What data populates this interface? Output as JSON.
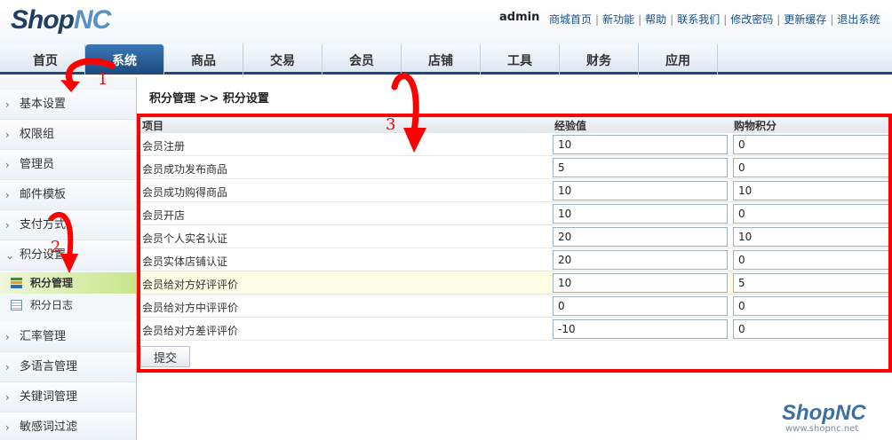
{
  "brand": {
    "logo_part1": "Shop",
    "logo_part2": "NC"
  },
  "header": {
    "admin_name": "admin",
    "links": [
      "商城首页",
      "新功能",
      "帮助",
      "联系我们",
      "修改密码",
      "更新缓存",
      "退出系统"
    ]
  },
  "nav": {
    "tabs": [
      {
        "label": "首页"
      },
      {
        "label": "系统"
      },
      {
        "label": "商品"
      },
      {
        "label": "交易"
      },
      {
        "label": "会员"
      },
      {
        "label": "店铺"
      },
      {
        "label": "工具"
      },
      {
        "label": "财务"
      },
      {
        "label": "应用"
      }
    ],
    "active_index": 1
  },
  "sidebar": {
    "items": [
      {
        "label": "基本设置"
      },
      {
        "label": "权限组"
      },
      {
        "label": "管理员"
      },
      {
        "label": "邮件模板"
      },
      {
        "label": "支付方式"
      },
      {
        "label": "积分设置"
      }
    ],
    "subitems": [
      {
        "label": "积分管理"
      },
      {
        "label": "积分日志"
      }
    ],
    "items_after": [
      {
        "label": "汇率管理"
      },
      {
        "label": "多语言管理"
      },
      {
        "label": "关键词管理"
      },
      {
        "label": "敏感词过滤"
      }
    ]
  },
  "main": {
    "breadcrumb": "积分管理 >> 积分设置",
    "columns": {
      "item": "项目",
      "exp": "经验值",
      "points": "购物积分"
    },
    "rows": [
      {
        "label": "会员注册",
        "exp": "10",
        "points": "0"
      },
      {
        "label": "会员成功发布商品",
        "exp": "5",
        "points": "0"
      },
      {
        "label": "会员成功购得商品",
        "exp": "10",
        "points": "10"
      },
      {
        "label": "会员开店",
        "exp": "10",
        "points": "0"
      },
      {
        "label": "会员个人实名认证",
        "exp": "20",
        "points": "10"
      },
      {
        "label": "会员实体店铺认证",
        "exp": "20",
        "points": "0"
      },
      {
        "label": "会员给对方好评评价",
        "exp": "10",
        "points": "5"
      },
      {
        "label": "会员给对方中评评价",
        "exp": "0",
        "points": "0"
      },
      {
        "label": "会员给对方差评评价",
        "exp": "-10",
        "points": "0"
      }
    ],
    "highlight_row": 6,
    "submit_label": "提交"
  },
  "annotations": {
    "n1": "1",
    "n2": "2",
    "n3": "3",
    "color": "#ff0000"
  },
  "watermark": {
    "logo": "ShopNC",
    "url": "www.shopnc.net"
  }
}
